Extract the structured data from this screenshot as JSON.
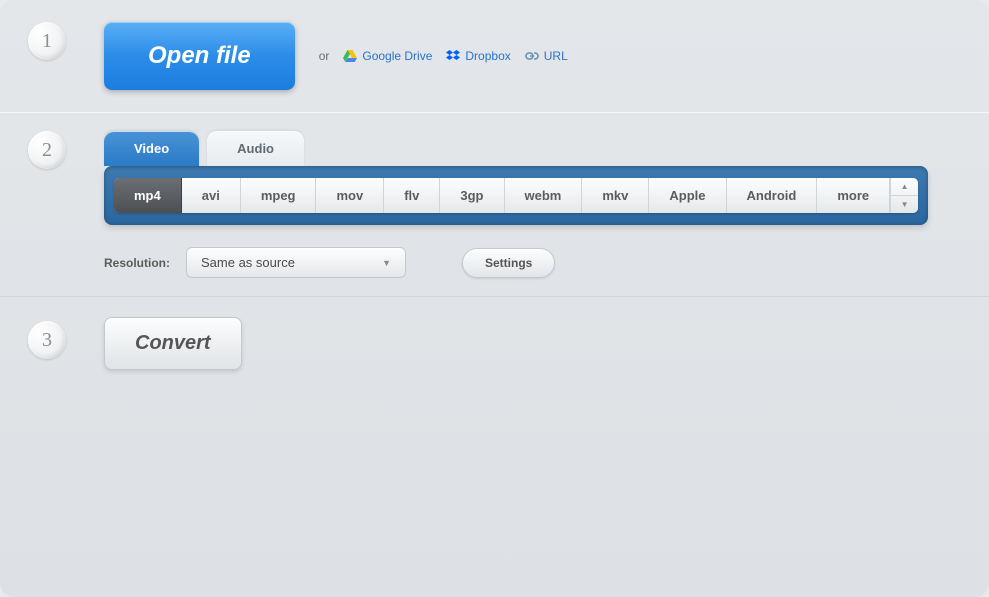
{
  "step1": {
    "number": "1",
    "open_label": "Open file",
    "or_label": "or",
    "sources": [
      {
        "label": "Google Drive",
        "icon": "google-drive-icon"
      },
      {
        "label": "Dropbox",
        "icon": "dropbox-icon"
      },
      {
        "label": "URL",
        "icon": "link-icon"
      }
    ]
  },
  "step2": {
    "number": "2",
    "tabs": [
      {
        "label": "Video",
        "active": true
      },
      {
        "label": "Audio",
        "active": false
      }
    ],
    "formats": [
      "mp4",
      "avi",
      "mpeg",
      "mov",
      "flv",
      "3gp",
      "webm",
      "mkv",
      "Apple",
      "Android",
      "more"
    ],
    "active_format": "mp4",
    "resolution_label": "Resolution:",
    "resolution_value": "Same as source",
    "settings_label": "Settings"
  },
  "step3": {
    "number": "3",
    "convert_label": "Convert"
  },
  "colors": {
    "primary_blue": "#2b8de8",
    "tab_active": "#2b7bc7",
    "format_active": "#4c5054",
    "link": "#2a73c7"
  }
}
